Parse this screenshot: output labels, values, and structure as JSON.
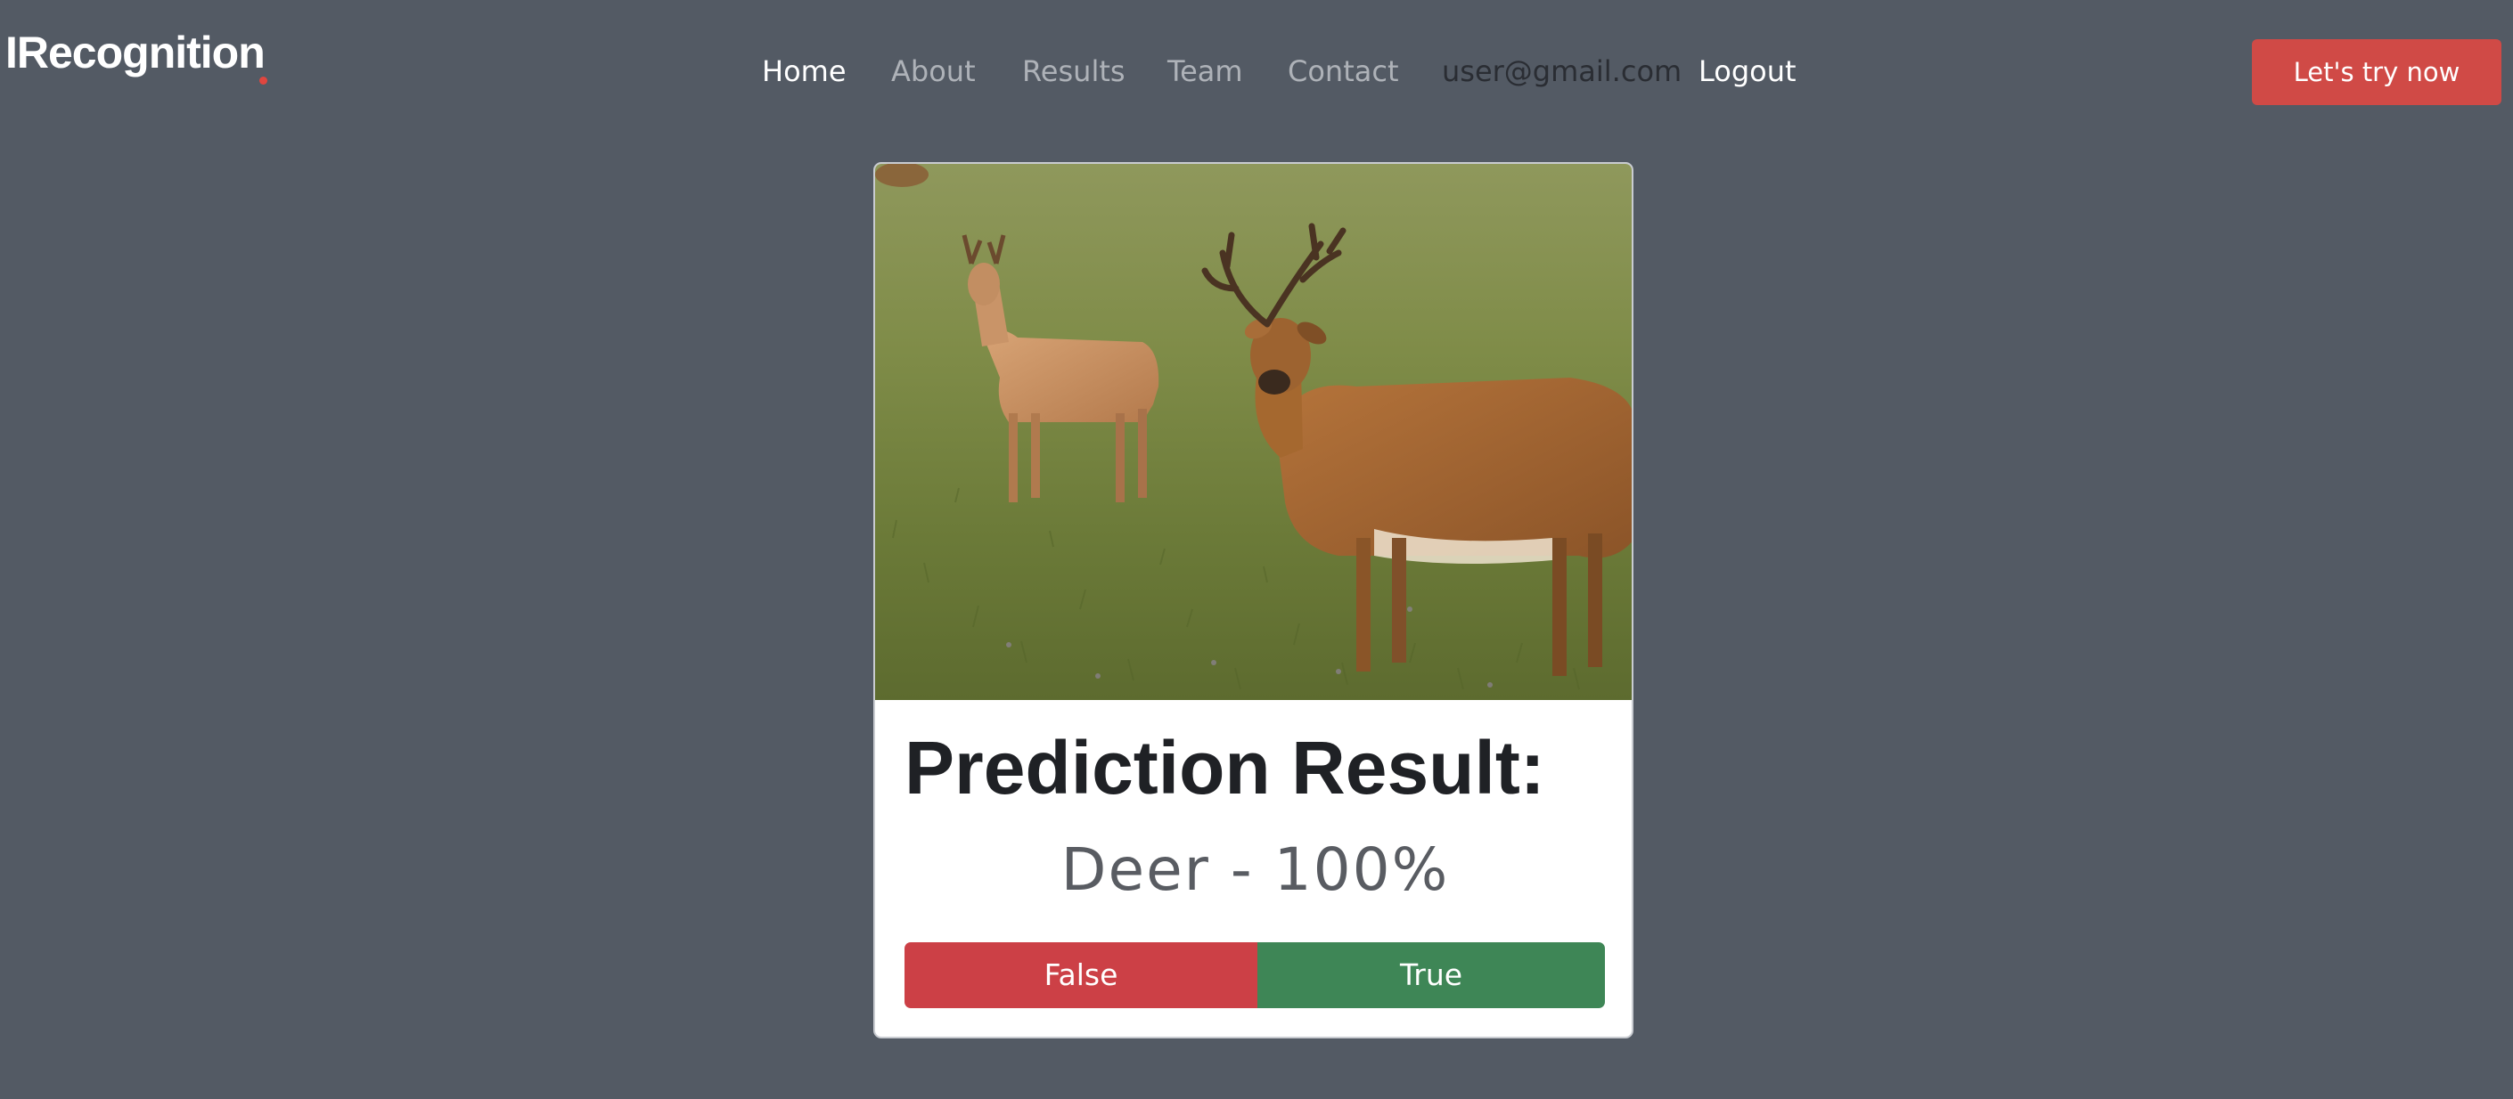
{
  "brand": {
    "name": "IRecognition",
    "accent_color": "#e0463f"
  },
  "nav": {
    "items": [
      {
        "label": "Home",
        "state": "active"
      },
      {
        "label": "About",
        "state": "muted"
      },
      {
        "label": "Results",
        "state": "muted"
      },
      {
        "label": "Team",
        "state": "muted"
      },
      {
        "label": "Contact",
        "state": "muted"
      },
      {
        "label": "user@gmail.com",
        "state": "user"
      },
      {
        "label": "Logout",
        "state": "active"
      }
    ],
    "cta_label": "Let's try now"
  },
  "card": {
    "image_icon": "deer-photo",
    "title": "Prediction Result:",
    "result": "Deer - 100%",
    "false_label": "False",
    "true_label": "True"
  },
  "colors": {
    "page_background": "#535a64",
    "cta": "#d04a46",
    "false_button": "#cc4046",
    "true_button": "#3e8656"
  }
}
